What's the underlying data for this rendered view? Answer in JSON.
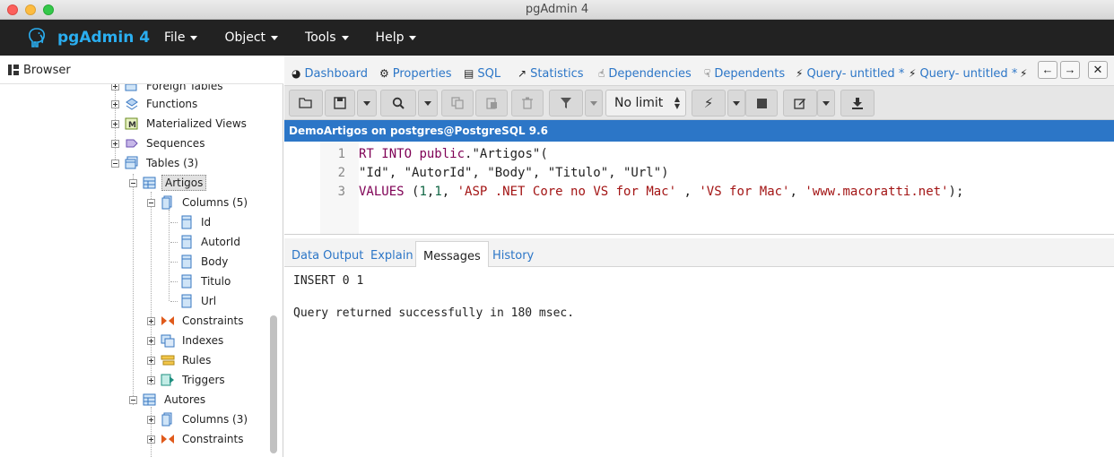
{
  "window": {
    "title": "pgAdmin 4"
  },
  "navbar": {
    "brand": "pgAdmin 4",
    "menus": [
      "File",
      "Object",
      "Tools",
      "Help"
    ]
  },
  "browser": {
    "title": "Browser",
    "tree": [
      {
        "label": "Foreign Tables",
        "icon": "foreign-tables-icon"
      },
      {
        "label": "Functions",
        "icon": "functions-icon"
      },
      {
        "label": "Materialized Views",
        "icon": "materialized-views-icon"
      },
      {
        "label": "Sequences",
        "icon": "sequences-icon"
      },
      {
        "label": "Tables (3)",
        "icon": "tables-icon"
      },
      {
        "label": "Artigos",
        "icon": "table-icon"
      },
      {
        "label": "Columns (5)",
        "icon": "columns-icon"
      },
      {
        "label": "Id",
        "icon": "column-icon"
      },
      {
        "label": "AutorId",
        "icon": "column-icon"
      },
      {
        "label": "Body",
        "icon": "column-icon"
      },
      {
        "label": "Titulo",
        "icon": "column-icon"
      },
      {
        "label": "Url",
        "icon": "column-icon"
      },
      {
        "label": "Constraints",
        "icon": "constraints-icon"
      },
      {
        "label": "Indexes",
        "icon": "indexes-icon"
      },
      {
        "label": "Rules",
        "icon": "rules-icon"
      },
      {
        "label": "Triggers",
        "icon": "triggers-icon"
      },
      {
        "label": "Autores",
        "icon": "table-icon"
      },
      {
        "label": "Columns (3)",
        "icon": "columns-icon"
      },
      {
        "label": "Constraints",
        "icon": "constraints-icon"
      }
    ]
  },
  "tabs": [
    {
      "label": "Dashboard",
      "icon": "dashboard-icon"
    },
    {
      "label": "Properties",
      "icon": "properties-icon"
    },
    {
      "label": "SQL",
      "icon": "sql-icon"
    },
    {
      "label": "Statistics",
      "icon": "statistics-icon"
    },
    {
      "label": "Dependencies",
      "icon": "dependencies-icon"
    },
    {
      "label": "Dependents",
      "icon": "dependents-icon"
    },
    {
      "label": "Query- untitled *",
      "icon": "query-icon"
    },
    {
      "label": "Query- untitled *",
      "icon": "query-icon"
    }
  ],
  "toolbar": {
    "limit_value": "No limit"
  },
  "connection": "DemoArtigos on postgres@PostgreSQL 9.6",
  "editor": {
    "line_numbers": [
      "1",
      "2",
      "3"
    ],
    "lines": [
      "RT INTO public.\"Artigos\"(",
      "\"Id\", \"AutorId\", \"Body\", \"Titulo\", \"Url\")",
      "VALUES (1,1, 'ASP .NET Core no VS for Mac' , 'VS for Mac', 'www.macoratti.net');"
    ]
  },
  "results": {
    "tabs": [
      "Data Output",
      "Explain",
      "Messages",
      "History"
    ],
    "active_tab": "Messages",
    "messages": [
      "INSERT 0 1",
      "Query returned successfully in 180 msec."
    ]
  },
  "colors": {
    "accent": "#2c76c7",
    "navbar": "#222222",
    "brand": "#2aaef0"
  }
}
